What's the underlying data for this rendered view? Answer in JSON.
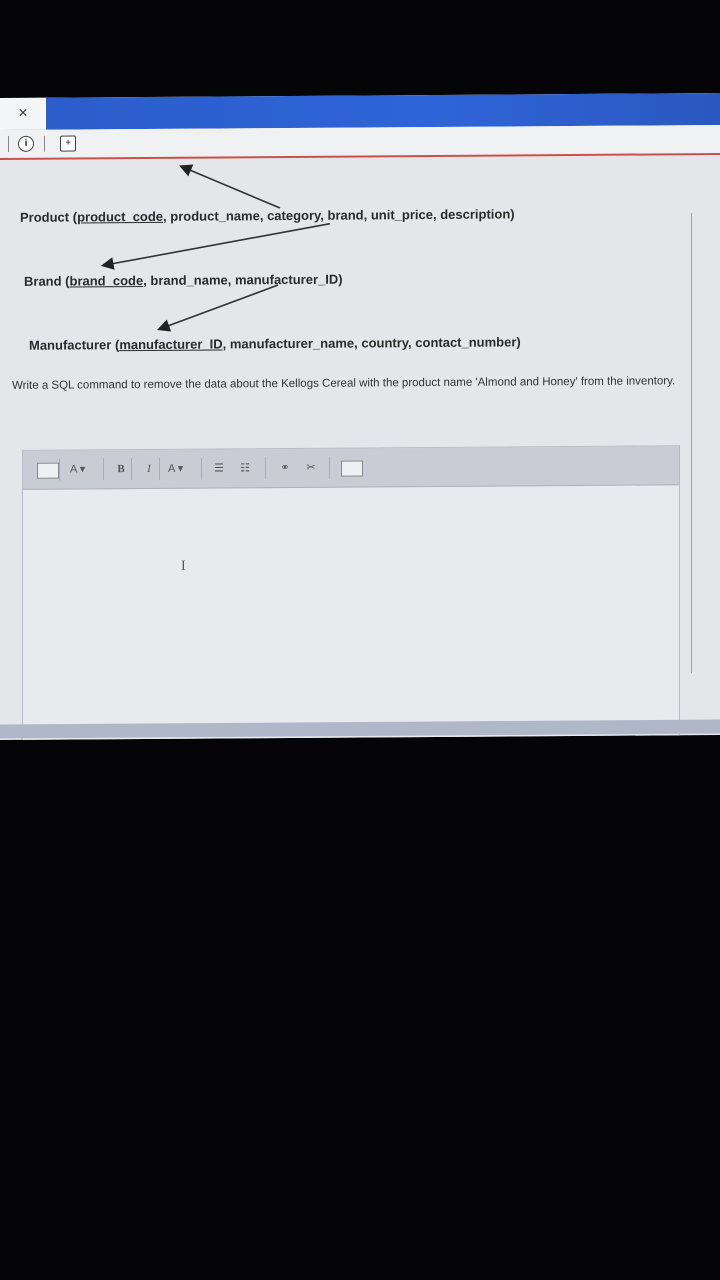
{
  "titlebar": {
    "close_label": "×"
  },
  "toolbar": {
    "info_label": "i",
    "save_label": "+"
  },
  "schemas": [
    {
      "table": "Product",
      "pk": "product_code",
      "rest": ", product_name, category, brand, unit_price, description)"
    },
    {
      "table": "Brand",
      "pk": "brand_code",
      "rest": ", brand_name, manufacturer_ID)"
    },
    {
      "table": "Manufacturer",
      "pk": "manufacturer_ID",
      "rest": ", manufacturer_name, country, contact_number)"
    }
  ],
  "question": "Write a SQL command to remove the data about the Kellogs Cereal with the product name 'Almond and Honey' from the inventory.",
  "editor": {
    "font_size_label": "A",
    "bold_label": "B",
    "italic_label": "I",
    "font_color_label": "A",
    "caret_glyph": "I",
    "answer_value": ""
  }
}
